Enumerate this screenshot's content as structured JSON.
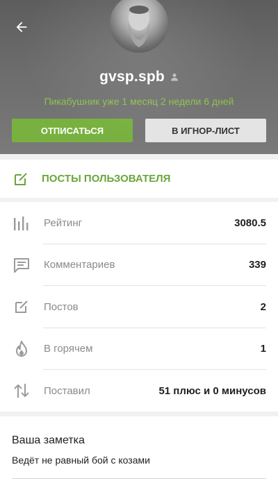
{
  "profile": {
    "username": "gvsp.spb",
    "tenure": "Пикабушник уже 1 месяц 2 недели 6 дней"
  },
  "actions": {
    "unsubscribe_label": "Отписаться",
    "ignore_label": "В игнор-лист"
  },
  "posts_section": {
    "label": "Посты пользователя"
  },
  "stats": [
    {
      "icon": "bar-chart-icon",
      "label": "Рейтинг",
      "value": "3080.5"
    },
    {
      "icon": "comment-icon",
      "label": "Комментариев",
      "value": "339"
    },
    {
      "icon": "edit-icon",
      "label": "Постов",
      "value": "2"
    },
    {
      "icon": "flame-icon",
      "label": "В горячем",
      "value": "1"
    },
    {
      "icon": "sort-arrows-icon",
      "label": "Поставил",
      "value": "51 плюс и 0 минусов"
    }
  ],
  "note": {
    "title": "Ваша заметка",
    "text": "Ведёт не равный бой с козами"
  },
  "colors": {
    "accent_green": "#78b13f",
    "tenure_green": "#8bc34a",
    "posts_green": "#6aa63a",
    "header_gray": "#6c6c6c"
  }
}
